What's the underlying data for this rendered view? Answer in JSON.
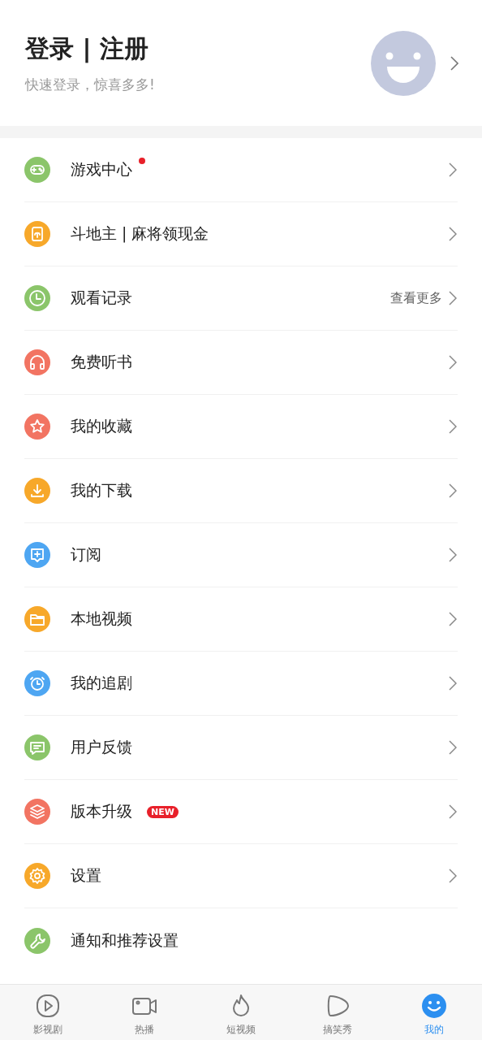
{
  "profile": {
    "title": "登录 | 注册",
    "subtitle": "快速登录，惊喜多多!"
  },
  "menu": [
    {
      "label": "游戏中心",
      "color": "#8bc56a",
      "dot": true,
      "chevron": true
    },
    {
      "label": "斗地主 | 麻将领现金",
      "color": "#f7a82a",
      "dot": false,
      "chevron": true
    },
    {
      "label": "观看记录",
      "color": "#8bc56a",
      "dot": false,
      "chevron": true,
      "trailing": "查看更多"
    },
    {
      "label": "免费听书",
      "color": "#f27462",
      "dot": false,
      "chevron": true
    },
    {
      "label": "我的收藏",
      "color": "#f27462",
      "dot": false,
      "chevron": true
    },
    {
      "label": "我的下载",
      "color": "#f7a82a",
      "dot": false,
      "chevron": true
    },
    {
      "label": "订阅",
      "color": "#4ea6f2",
      "dot": false,
      "chevron": true
    },
    {
      "label": "本地视频",
      "color": "#f7a82a",
      "dot": false,
      "chevron": true
    },
    {
      "label": "我的追剧",
      "color": "#4ea6f2",
      "dot": false,
      "chevron": true
    },
    {
      "label": "用户反馈",
      "color": "#8bc56a",
      "dot": false,
      "chevron": true
    },
    {
      "label": "版本升级",
      "color": "#f27462",
      "dot": false,
      "chevron": true,
      "badge": "NEW"
    },
    {
      "label": "设置",
      "color": "#f7a82a",
      "dot": false,
      "chevron": true
    },
    {
      "label": "通知和推荐设置",
      "color": "#8bc56a",
      "dot": false,
      "chevron": false
    }
  ],
  "tabs": [
    {
      "label": "影视剧",
      "selected": false
    },
    {
      "label": "热播",
      "selected": false
    },
    {
      "label": "短视频",
      "selected": false
    },
    {
      "label": "搞笑秀",
      "selected": false
    },
    {
      "label": "我的",
      "selected": true
    }
  ]
}
